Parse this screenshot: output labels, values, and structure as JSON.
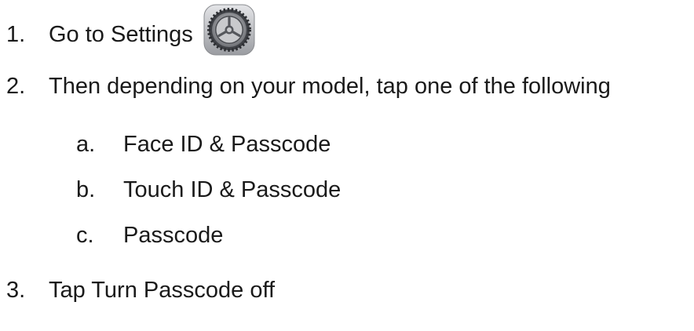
{
  "steps": [
    {
      "number": "1.",
      "text": "Go to Settings"
    },
    {
      "number": "2.",
      "text": "Then depending on your model, tap one of the following"
    },
    {
      "number": "3.",
      "text": "Tap Turn Passcode off"
    }
  ],
  "substeps": [
    {
      "letter": "a.",
      "text": "Face ID & Passcode"
    },
    {
      "letter": "b.",
      "text": "Touch ID & Passcode"
    },
    {
      "letter": "c.",
      "text": "Passcode"
    }
  ],
  "icons": {
    "settings": "settings-gear-icon"
  }
}
